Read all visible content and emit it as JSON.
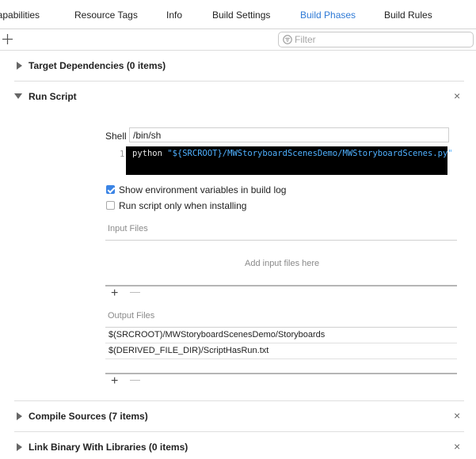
{
  "tabs": [
    {
      "label": "Capabilities",
      "active": false
    },
    {
      "label": "Resource Tags",
      "active": false
    },
    {
      "label": "Info",
      "active": false
    },
    {
      "label": "Build Settings",
      "active": false
    },
    {
      "label": "Build Phases",
      "active": true
    },
    {
      "label": "Build Rules",
      "active": false
    }
  ],
  "toolbar": {
    "add_icon": "plus-icon",
    "filter_placeholder": "Filter",
    "filter_icon": "filter-icon"
  },
  "sections": {
    "target_dependencies": {
      "title": "Target Dependencies (0 items)"
    },
    "run_script": {
      "title": "Run Script",
      "shell_label": "Shell",
      "shell_value": "/bin/sh",
      "line_number": "1",
      "code_keyword": "python",
      "code_string": "\"${SRCROOT}/MWStoryboardScenesDemo/MWStoryboardScenes.py\"",
      "option_env": {
        "label": "Show environment variables in build log",
        "checked": true
      },
      "option_install": {
        "label": "Run script only when installing",
        "checked": false
      },
      "input_files_label": "Input Files",
      "input_files_empty": "Add input files here",
      "output_files_label": "Output Files",
      "output_files": [
        "$(SRCROOT)/MWStoryboardScenesDemo/Storyboards",
        "$(DERIVED_FILE_DIR)/ScriptHasRun.txt"
      ]
    },
    "compile_sources": {
      "title": "Compile Sources (7 items)"
    },
    "link_binary": {
      "title": "Link Binary With Libraries (0 items)"
    }
  },
  "symbols": {
    "plus": "+",
    "minus": "—",
    "close": "×"
  },
  "colors": {
    "accent": "#2f7ad6",
    "editor_bg": "#000000",
    "code_keyword": "#e8e8e8",
    "code_string": "#4fb0ff"
  }
}
